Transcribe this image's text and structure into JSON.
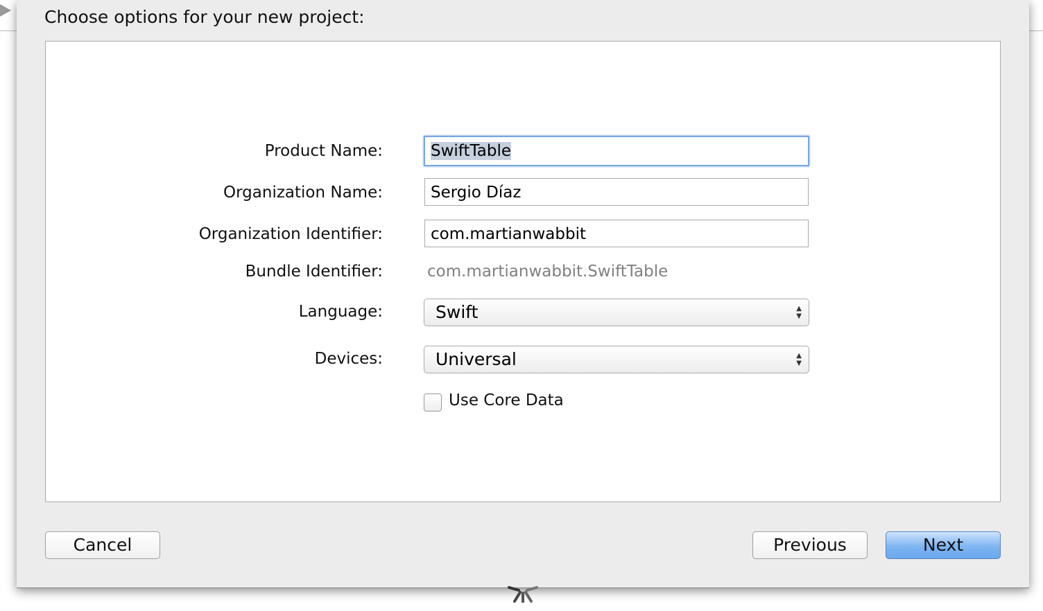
{
  "dialog": {
    "title": "Choose options for your new project:"
  },
  "form": {
    "product_name": {
      "label": "Product Name:",
      "value": "SwiftTable"
    },
    "organization_name": {
      "label": "Organization Name:",
      "value": "Sergio Díaz"
    },
    "organization_identifier": {
      "label": "Organization Identifier:",
      "value": "com.martianwabbit"
    },
    "bundle_identifier": {
      "label": "Bundle Identifier:",
      "value": "com.martianwabbit.SwiftTable"
    },
    "language": {
      "label": "Language:",
      "value": "Swift"
    },
    "devices": {
      "label": "Devices:",
      "value": "Universal"
    },
    "core_data": {
      "label": "Use Core Data",
      "checked": false
    }
  },
  "buttons": {
    "cancel": "Cancel",
    "previous": "Previous",
    "next": "Next"
  },
  "colors": {
    "accent": "#7fb5f1",
    "focus_ring": "#7aa7e0"
  }
}
